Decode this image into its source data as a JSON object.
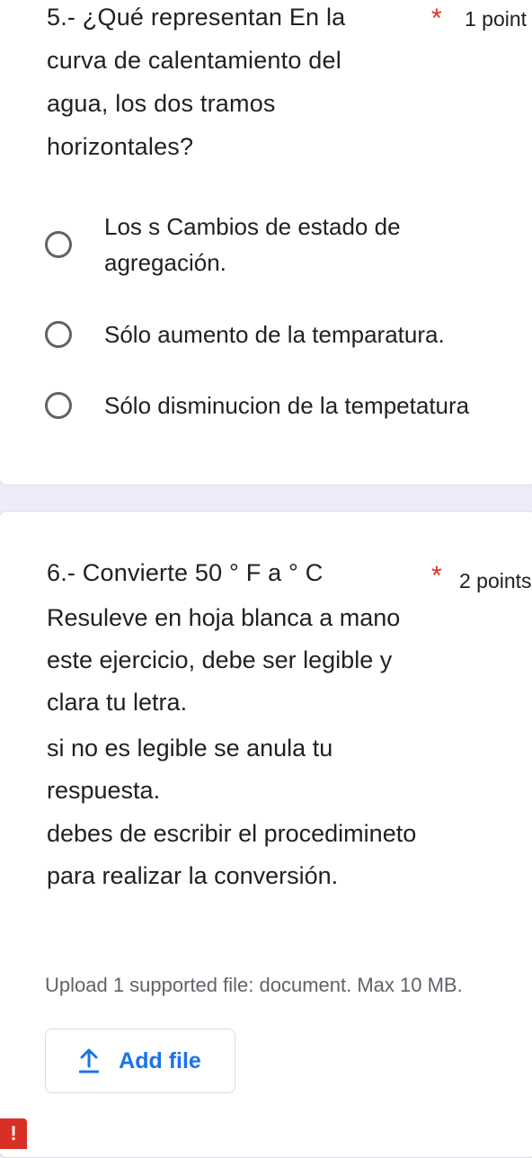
{
  "question5": {
    "title": "5.- ¿Qué representan En la curva de calentamiento del agua, los dos tramos horizontales?",
    "required_mark": "*",
    "points": "1 point",
    "options": [
      {
        "label": "Los s Cambios de estado de agregación.",
        "selected": false
      },
      {
        "label": "Sólo aumento de la temparatura.",
        "selected": false
      },
      {
        "label": "Sólo disminucion de la tempetatura",
        "selected": false
      }
    ]
  },
  "question6": {
    "title": "6.- Convierte 50 ° F  a  ° C",
    "required_mark": "*",
    "points": "2 points",
    "description": [
      "Resuleve en hoja blanca a mano este ejercicio, debe ser legible y clara  tu letra.",
      "si no es legible se anula tu respuesta.",
      "debes de escribir el procedimineto  para realizar la conversión."
    ],
    "upload_note": "Upload 1 supported file: document. Max 10 MB.",
    "add_file_label": "Add file",
    "add_file_icon": "upload-icon"
  },
  "error_marker": "!",
  "colors": {
    "page_background": "#f0ebf8",
    "required_star": "#d93025",
    "accent": "#1a73e8",
    "error": "#d93025"
  }
}
